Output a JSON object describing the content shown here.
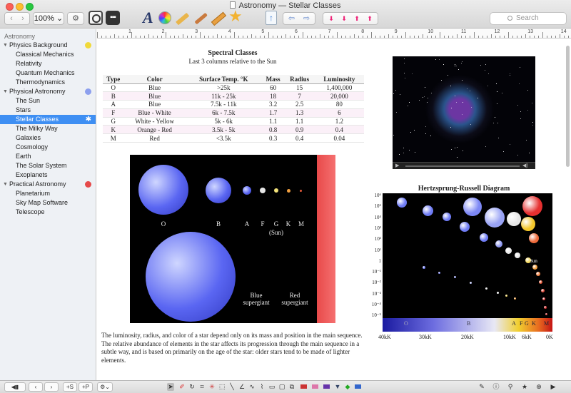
{
  "window": {
    "title": "Astronomy — Stellar Classes"
  },
  "toolbar": {
    "zoom": "100%",
    "search_placeholder": "Search"
  },
  "sidebar": {
    "header": "Astronomy",
    "groups": [
      {
        "label": "Physics Background",
        "color": "#f0d93a",
        "items": [
          "Classical Mechanics",
          "Relativity",
          "Quantum Mechanics",
          "Thermodynamics"
        ]
      },
      {
        "label": "Physical Astronomy",
        "color": "#6b84e8",
        "items": [
          "The Sun",
          "Stars",
          "Stellar Classes",
          "The Milky Way",
          "Galaxies",
          "Cosmology",
          "Earth",
          "The Solar System",
          "Exoplanets"
        ]
      },
      {
        "label": "Practical Astronomy",
        "color": "#e64a4a",
        "items": [
          "Planetarium",
          "Sky Map Software",
          "Telescope"
        ]
      }
    ],
    "selected": "Stellar Classes"
  },
  "ruler": {
    "numbers": [
      "1",
      "2",
      "3",
      "4",
      "5",
      "6",
      "7",
      "8",
      "9",
      "10",
      "11",
      "12",
      "13",
      "14"
    ]
  },
  "document": {
    "table_title": "Spectral Classes",
    "table_subtitle": "Last 3 columns relative to the Sun",
    "columns": [
      "Type",
      "Color",
      "Surface Temp. °K",
      "Mass",
      "Radius",
      "Luminosity"
    ],
    "rows": [
      [
        "O",
        "Blue",
        ">25k",
        "60",
        "15",
        "1,400,000"
      ],
      [
        "B",
        "Blue",
        "11k - 25k",
        "18",
        "7",
        "20,000"
      ],
      [
        "A",
        "Blue",
        "7.5k - 11k",
        "3.2",
        "2.5",
        "80"
      ],
      [
        "F",
        "Blue - White",
        "6k - 7.5k",
        "1.7",
        "1.3",
        "6"
      ],
      [
        "G",
        "White - Yellow",
        "5k - 6k",
        "1.1",
        "1.1",
        "1.2"
      ],
      [
        "K",
        "Orange - Red",
        "3.5k - 5k",
        "0.8",
        "0.9",
        "0.4"
      ],
      [
        "M",
        "Red",
        "<3.5k",
        "0.3",
        "0.4",
        "0.04"
      ]
    ],
    "star_labels": {
      "o": "O",
      "b": "B",
      "a": "A",
      "f": "F",
      "g": "G",
      "k": "K",
      "m": "M",
      "sun": "(Sun)",
      "blue_supergiant": "Blue supergiant",
      "red_supergiant": "Red supergiant"
    },
    "paragraph": "The luminosity, radius, and color of a star depend only on its mass and position in the main sequence. The relative abundance of elements in the star affects its progression through the main sequence in a subtle way, and is based on primarily on the age of the star: older stars tend to be made of lighter elements.",
    "hr": {
      "title": "Hertzsprung-Russell Diagram",
      "y_labels": [
        "10⁶",
        "10⁵",
        "10⁴",
        "10³",
        "10²",
        "10¹",
        "1",
        "10⁻¹",
        "10⁻²",
        "10⁻³",
        "10⁻⁴",
        "10⁻⁵"
      ],
      "band_labels": [
        "O",
        "B",
        "A",
        "F",
        "G",
        "K",
        "M"
      ],
      "x_labels": [
        "40kK",
        "30kK",
        "20kK",
        "10kK",
        "6kK",
        "0K"
      ],
      "sun_label": "Sun"
    }
  },
  "bottombar": {
    "add_sibling": "+S",
    "add_page": "+P"
  }
}
